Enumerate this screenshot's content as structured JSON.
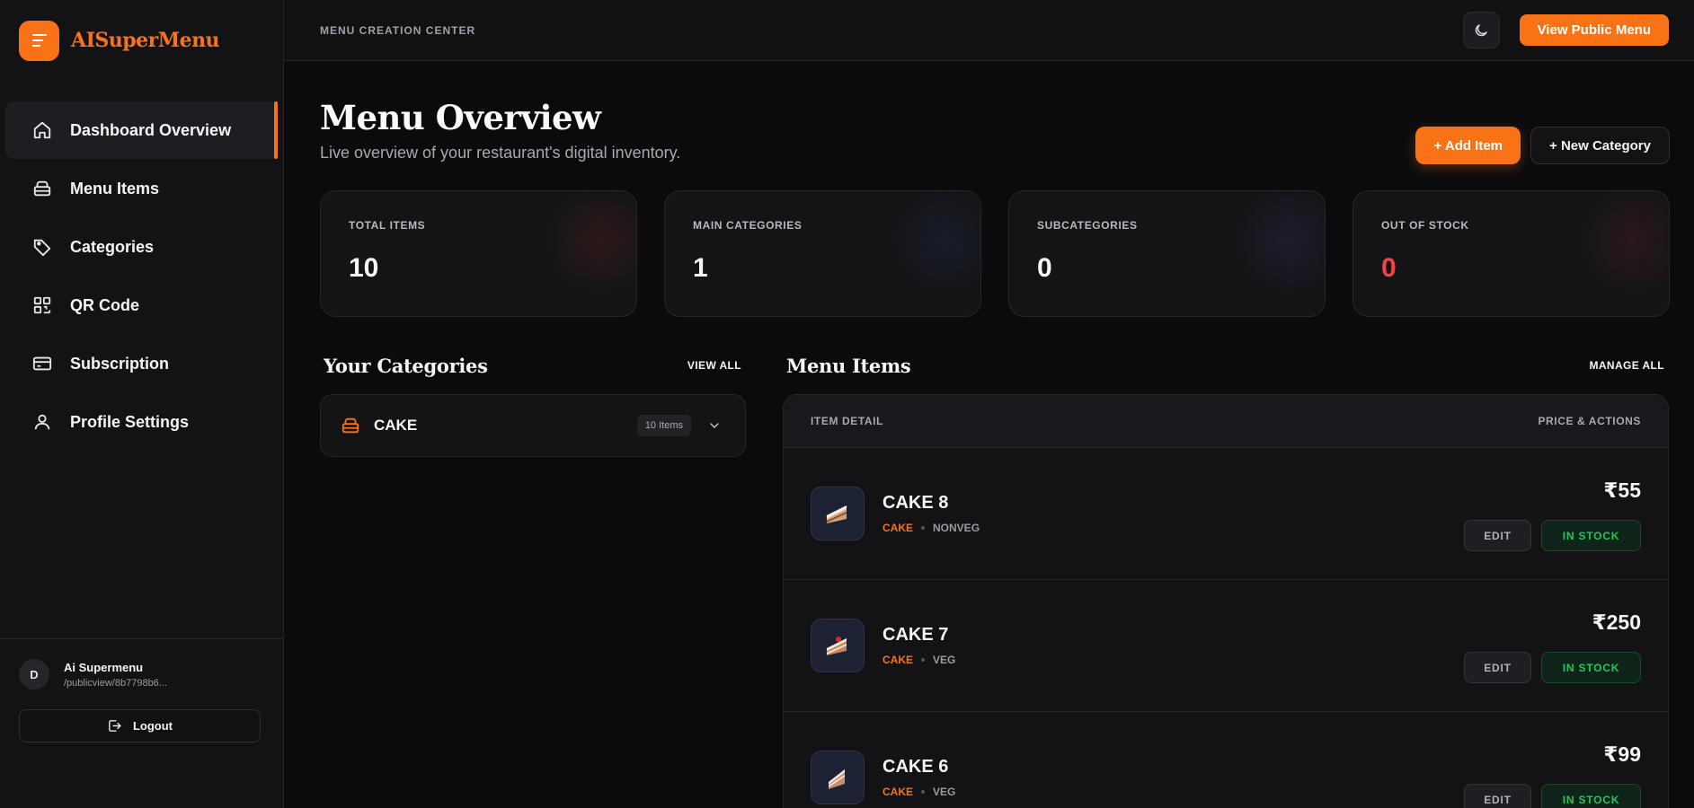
{
  "brand": {
    "name": "AISuperMenu"
  },
  "sidebar": {
    "items": [
      {
        "label": "Dashboard Overview",
        "icon": "home-icon"
      },
      {
        "label": "Menu Items",
        "icon": "menu-box-icon"
      },
      {
        "label": "Categories",
        "icon": "tag-icon"
      },
      {
        "label": "QR Code",
        "icon": "qr-code-icon"
      },
      {
        "label": "Subscription",
        "icon": "credit-card-icon"
      },
      {
        "label": "Profile Settings",
        "icon": "user-icon"
      }
    ],
    "active_index": 0
  },
  "user": {
    "initial": "D",
    "name": "Ai Supermenu",
    "path": "/publicview/8b7798b6..."
  },
  "logout_label": "Logout",
  "topbar": {
    "title": "MENU CREATION CENTER",
    "public_button": "View Public Menu"
  },
  "header": {
    "title": "Menu Overview",
    "subtitle": "Live overview of your restaurant's digital inventory.",
    "add_item": "+ Add Item",
    "new_category": "+ New Category"
  },
  "stats": [
    {
      "label": "TOTAL ITEMS",
      "value": "10"
    },
    {
      "label": "MAIN CATEGORIES",
      "value": "1"
    },
    {
      "label": "SUBCATEGORIES",
      "value": "0"
    },
    {
      "label": "OUT OF STOCK",
      "value": "0"
    }
  ],
  "categories_section": {
    "title": "Your Categories",
    "link": "VIEW ALL",
    "items": [
      {
        "name": "CAKE",
        "count": "10 Items"
      }
    ]
  },
  "items_section": {
    "title": "Menu Items",
    "link": "MANAGE ALL",
    "col_left": "ITEM DETAIL",
    "col_right": "PRICE & ACTIONS",
    "rows": [
      {
        "name": "CAKE 8",
        "category": "CAKE",
        "type": "NONVEG",
        "price": "₹55",
        "edit": "EDIT",
        "stock": "IN STOCK"
      },
      {
        "name": "CAKE 7",
        "category": "CAKE",
        "type": "VEG",
        "price": "₹250",
        "edit": "EDIT",
        "stock": "IN STOCK"
      },
      {
        "name": "CAKE 6",
        "category": "CAKE",
        "type": "VEG",
        "price": "₹99",
        "edit": "EDIT",
        "stock": "IN STOCK"
      }
    ]
  },
  "colors": {
    "accent": "#f97316",
    "danger": "#ef4444",
    "success": "#22c55e",
    "background": "#0b0b0e"
  }
}
